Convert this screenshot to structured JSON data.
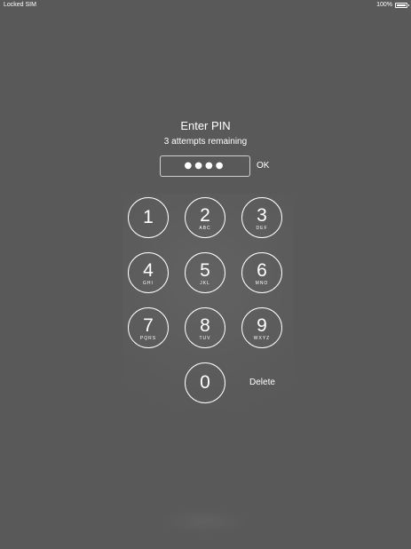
{
  "status_bar": {
    "carrier": "Locked SIM",
    "battery": "100%"
  },
  "pin_entry": {
    "title": "Enter PIN",
    "subtitle": "3 attempts remaining",
    "masked_value": "●●●●",
    "ok_label": "OK",
    "delete_label": "Delete"
  },
  "keypad": {
    "keys": [
      {
        "digit": "1",
        "letters": ""
      },
      {
        "digit": "2",
        "letters": "ABC"
      },
      {
        "digit": "3",
        "letters": "DEF"
      },
      {
        "digit": "4",
        "letters": "GHI"
      },
      {
        "digit": "5",
        "letters": "JKL"
      },
      {
        "digit": "6",
        "letters": "MNO"
      },
      {
        "digit": "7",
        "letters": "PQRS"
      },
      {
        "digit": "8",
        "letters": "TUV"
      },
      {
        "digit": "9",
        "letters": "WXYZ"
      },
      {
        "digit": "0",
        "letters": ""
      }
    ]
  },
  "colors": {
    "background": "#595959",
    "foreground": "#ffffff"
  }
}
